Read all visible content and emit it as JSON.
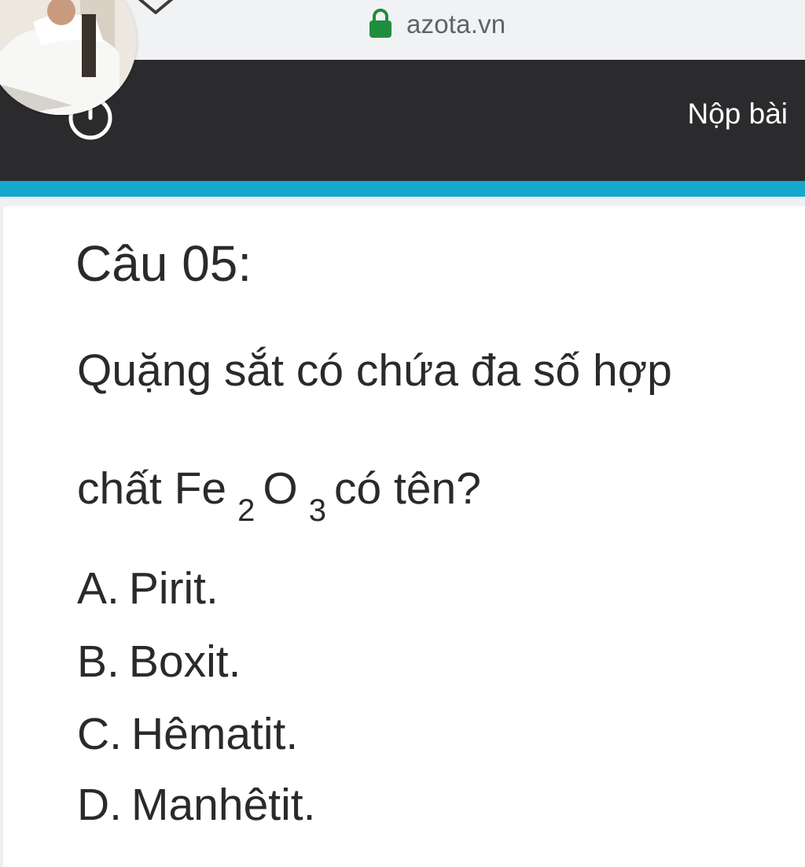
{
  "browser": {
    "url": "azota.vn",
    "icons": {
      "lock": "lock-icon",
      "collapse": "chevron-down-icon"
    },
    "lock_color": "#1e8e3e"
  },
  "header": {
    "submit_label": "Nộp bài",
    "icons": {
      "timer": "clock-icon",
      "avatar": "avatar"
    },
    "background": "#2b2b2d",
    "accent": "#14a8cf"
  },
  "question": {
    "title": "Câu 05:",
    "line1": "Quặng sắt có chứa đa số hợp",
    "line2_prefix": "chất Fe",
    "sub_2": "2",
    "middle": "O",
    "sub_3": "3",
    "line2_suffix": "có tên?",
    "options": [
      {
        "letter": "A.",
        "text": "Pirit."
      },
      {
        "letter": "B.",
        "text": "Boxit."
      },
      {
        "letter": "C.",
        "text": "Hêmatit."
      },
      {
        "letter": "D.",
        "text": "Manhêtit."
      }
    ]
  }
}
